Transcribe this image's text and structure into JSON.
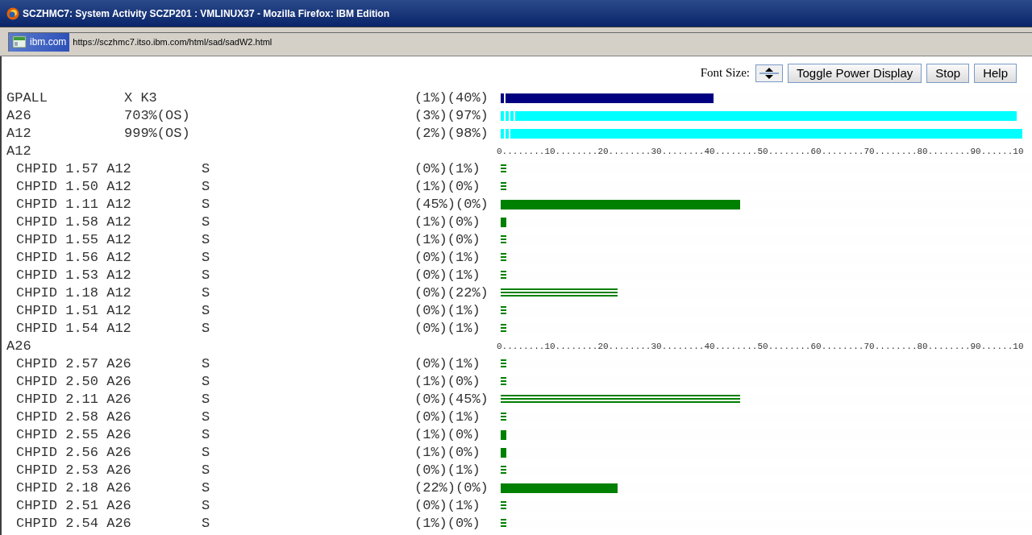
{
  "window": {
    "title": "SCZHMC7: System Activity SCZP201 : VMLINUX37 - Mozilla Firefox: IBM Edition"
  },
  "address_bar": {
    "site_label": "ibm.com",
    "url": "https://sczhmc7.itso.ibm.com/html/sad/sadW2.html"
  },
  "toolbar": {
    "font_size_label": "Font Size:",
    "buttons": [
      "Toggle Power Display",
      "Stop",
      "Help"
    ]
  },
  "summary_rows": [
    {
      "name": "GPALL",
      "value": "X K3",
      "reading": "(1%)(40%)",
      "bar": {
        "color": "#000080",
        "segments": [
          {
            "kind": "ticked",
            "level": 0.01
          },
          {
            "kind": "solid",
            "level": 0.4
          }
        ]
      }
    },
    {
      "name": "A26",
      "value": "703%(OS)",
      "reading": "(3%)(97%)",
      "bar": {
        "color": "#00ffff",
        "segments": [
          {
            "kind": "ticked",
            "level": 0.03
          },
          {
            "kind": "solid",
            "level": 0.97
          }
        ]
      }
    },
    {
      "name": "A12",
      "value": "999%(OS)",
      "reading": "(2%)(98%)",
      "bar": {
        "color": "#00ffff",
        "segments": [
          {
            "kind": "ticked",
            "level": 0.02
          },
          {
            "kind": "solid",
            "level": 0.98
          }
        ]
      }
    }
  ],
  "groups": [
    {
      "name": "A12",
      "scale": "0........10........20........30........40........50........60........70........80........90......10",
      "rows": [
        {
          "channel": "CHPID 1.57 A12",
          "type": "S",
          "reading": "(0%)(1%)",
          "bar": {
            "kind": "lined",
            "level": 0.01
          }
        },
        {
          "channel": "CHPID 1.50 A12",
          "type": "S",
          "reading": "(1%)(0%)",
          "bar": {
            "kind": "lined",
            "level": 0.01
          }
        },
        {
          "channel": "CHPID 1.11 A12",
          "type": "S",
          "reading": "(45%)(0%)",
          "bar": {
            "kind": "solid",
            "level": 0.45
          }
        },
        {
          "channel": "CHPID 1.58 A12",
          "type": "S",
          "reading": "(1%)(0%)",
          "bar": {
            "kind": "solid",
            "level": 0.01
          }
        },
        {
          "channel": "CHPID 1.55 A12",
          "type": "S",
          "reading": "(1%)(0%)",
          "bar": {
            "kind": "lined",
            "level": 0.01
          }
        },
        {
          "channel": "CHPID 1.56 A12",
          "type": "S",
          "reading": "(0%)(1%)",
          "bar": {
            "kind": "lined",
            "level": 0.01
          }
        },
        {
          "channel": "CHPID 1.53 A12",
          "type": "S",
          "reading": "(0%)(1%)",
          "bar": {
            "kind": "lined",
            "level": 0.01
          }
        },
        {
          "channel": "CHPID 1.18 A12",
          "type": "S",
          "reading": "(0%)(22%)",
          "bar": {
            "kind": "lined",
            "level": 0.22
          }
        },
        {
          "channel": "CHPID 1.51 A12",
          "type": "S",
          "reading": "(0%)(1%)",
          "bar": {
            "kind": "lined",
            "level": 0.01
          }
        },
        {
          "channel": "CHPID 1.54 A12",
          "type": "S",
          "reading": "(0%)(1%)",
          "bar": {
            "kind": "lined",
            "level": 0.01
          }
        }
      ]
    },
    {
      "name": "A26",
      "scale": "0........10........20........30........40........50........60........70........80........90......10",
      "rows": [
        {
          "channel": "CHPID 2.57 A26",
          "type": "S",
          "reading": "(0%)(1%)",
          "bar": {
            "kind": "lined",
            "level": 0.01
          }
        },
        {
          "channel": "CHPID 2.50 A26",
          "type": "S",
          "reading": "(1%)(0%)",
          "bar": {
            "kind": "lined",
            "level": 0.01
          }
        },
        {
          "channel": "CHPID 2.11 A26",
          "type": "S",
          "reading": "(0%)(45%)",
          "bar": {
            "kind": "lined",
            "level": 0.45
          }
        },
        {
          "channel": "CHPID 2.58 A26",
          "type": "S",
          "reading": "(0%)(1%)",
          "bar": {
            "kind": "lined",
            "level": 0.01
          }
        },
        {
          "channel": "CHPID 2.55 A26",
          "type": "S",
          "reading": "(1%)(0%)",
          "bar": {
            "kind": "solid",
            "level": 0.01
          }
        },
        {
          "channel": "CHPID 2.56 A26",
          "type": "S",
          "reading": "(1%)(0%)",
          "bar": {
            "kind": "solid",
            "level": 0.01
          }
        },
        {
          "channel": "CHPID 2.53 A26",
          "type": "S",
          "reading": "(0%)(1%)",
          "bar": {
            "kind": "lined",
            "level": 0.01
          }
        },
        {
          "channel": "CHPID 2.18 A26",
          "type": "S",
          "reading": "(22%)(0%)",
          "bar": {
            "kind": "solid",
            "level": 0.22
          }
        },
        {
          "channel": "CHPID 2.51 A26",
          "type": "S",
          "reading": "(0%)(1%)",
          "bar": {
            "kind": "lined",
            "level": 0.01
          }
        },
        {
          "channel": "CHPID 2.54 A26",
          "type": "S",
          "reading": "(1%)(0%)",
          "bar": {
            "kind": "lined",
            "level": 0.01
          }
        }
      ]
    }
  ]
}
